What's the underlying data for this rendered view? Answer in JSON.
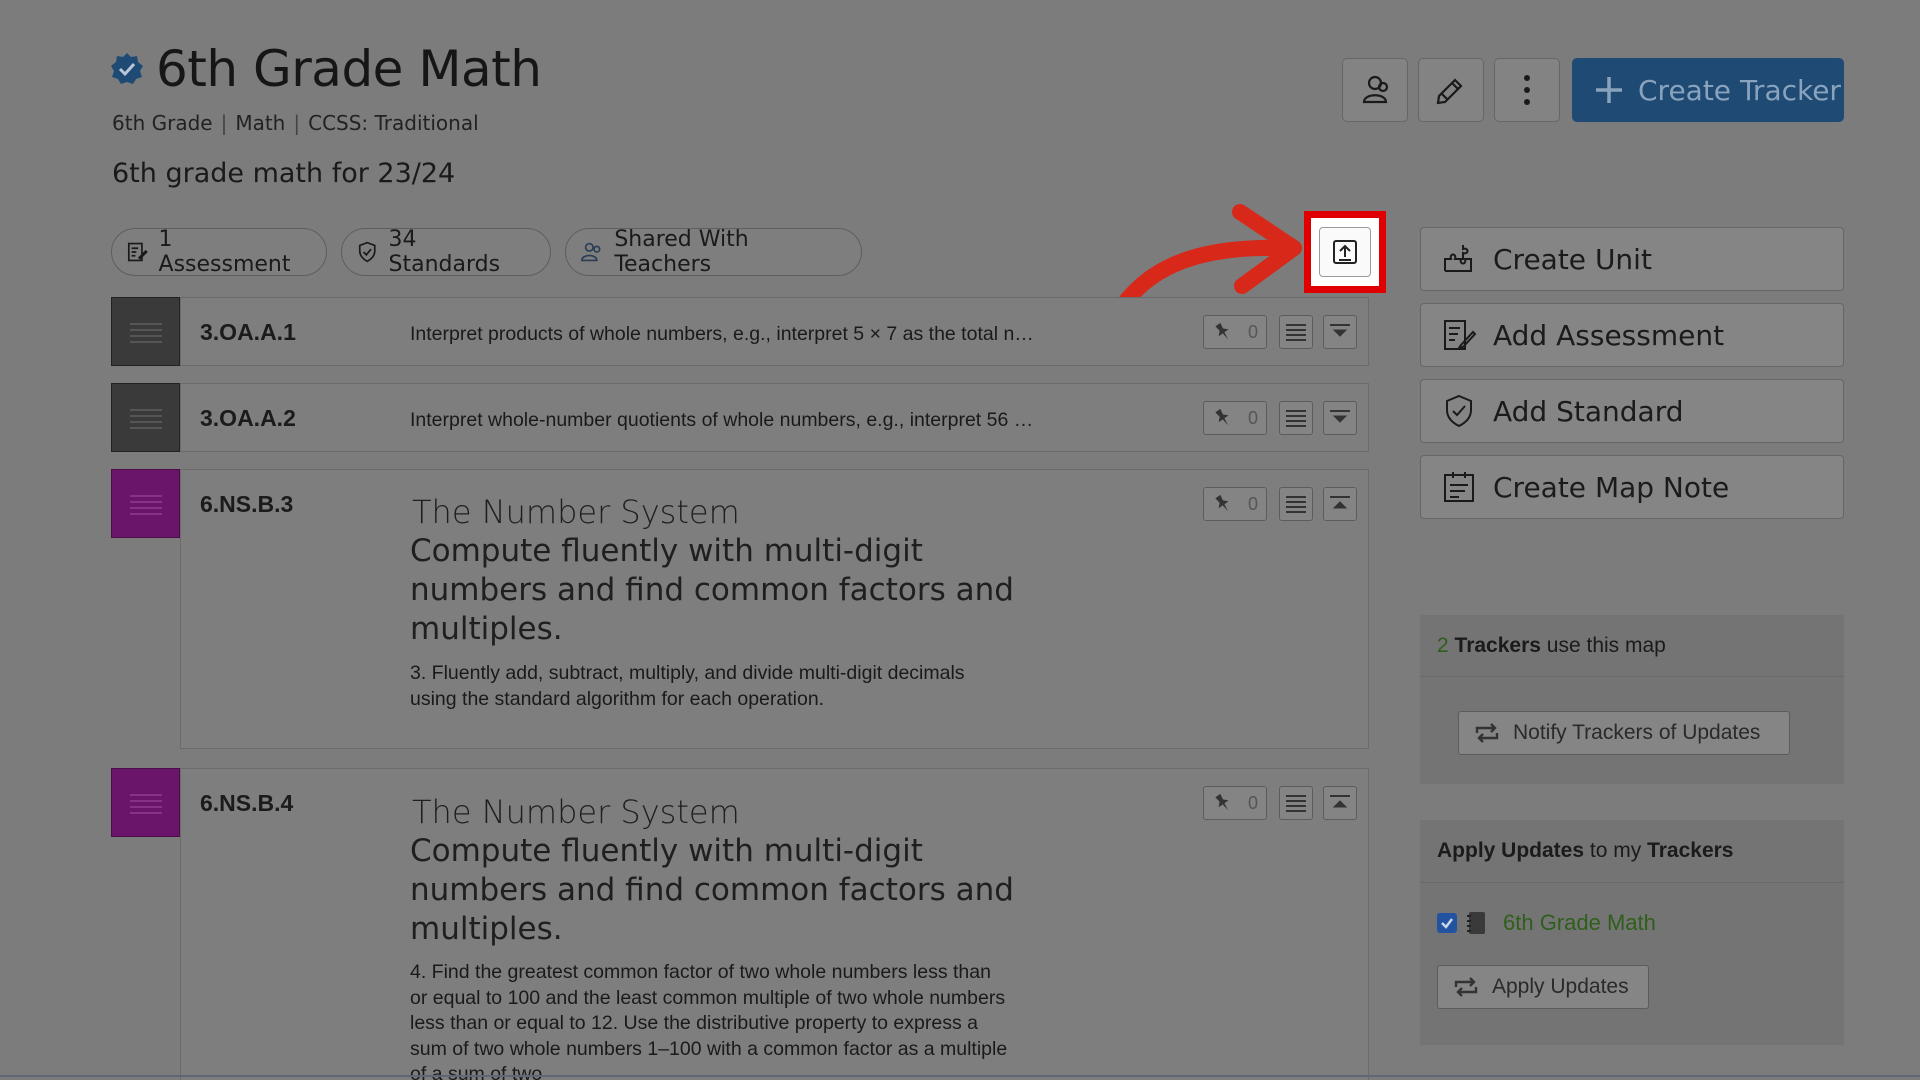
{
  "header": {
    "title": "6th Grade Math",
    "meta": [
      "6th Grade",
      "Math",
      "CCSS: Traditional"
    ],
    "separator": "|",
    "description": "6th grade math for 23/24",
    "create_tracker_label": "Create Tracker"
  },
  "pills": [
    {
      "label": "1 Assessment"
    },
    {
      "label": "34 Standards"
    },
    {
      "label": "Shared With Teachers"
    }
  ],
  "standards": [
    {
      "code": "3.OA.A.1",
      "text": "Interpret products of whole numbers, e.g., interpret 5 × 7 as the total n…",
      "count": "0",
      "color": "#3a3a3a"
    },
    {
      "code": "3.OA.A.2",
      "text": "Interpret whole-number quotients of whole numbers, e.g., interpret 56 …",
      "count": "0",
      "color": "#3a3a3a"
    },
    {
      "code": "6.NS.B.3",
      "domain": "The Number System",
      "cluster": "Compute fluently with multi-digit numbers and find common factors and multiples.",
      "detail": "3. Fluently add, subtract, multiply, and divide multi-digit decimals using the standard algorithm for each operation.",
      "count": "0",
      "color": "#6a1569"
    },
    {
      "code": "6.NS.B.4",
      "domain": "The Number System",
      "cluster": "Compute fluently with multi-digit numbers and find common factors and multiples.",
      "detail": "4. Find the greatest common factor of two whole numbers less than or equal to 100 and the least common multiple of two whole numbers less than or equal to 12. Use the distributive property to express a sum of two whole numbers 1–100 with a common factor as a multiple of a sum of two",
      "count": "0",
      "color": "#6a1569"
    }
  ],
  "sidebar": {
    "actions": [
      {
        "label": "Create Unit",
        "icon": "puzzle-icon"
      },
      {
        "label": "Add Assessment",
        "icon": "assessment-icon"
      },
      {
        "label": "Add Standard",
        "icon": "shield-check-icon"
      },
      {
        "label": "Create Map Note",
        "icon": "map-note-icon"
      }
    ],
    "trackers_panel": {
      "count": "2",
      "bold": "Trackers",
      "rest": "use this map",
      "notify_label": "Notify Trackers of Updates"
    },
    "apply_panel": {
      "bold1": "Apply Updates",
      "mid": "to my",
      "bold2": "Trackers",
      "tracker_name": "6th Grade Math",
      "checked": true,
      "apply_label": "Apply Updates"
    }
  },
  "colors": {
    "overlay": "#7c7c7c",
    "primary": "#1e4a74",
    "highlight": "#e00000",
    "green": "#2f5f1a"
  }
}
